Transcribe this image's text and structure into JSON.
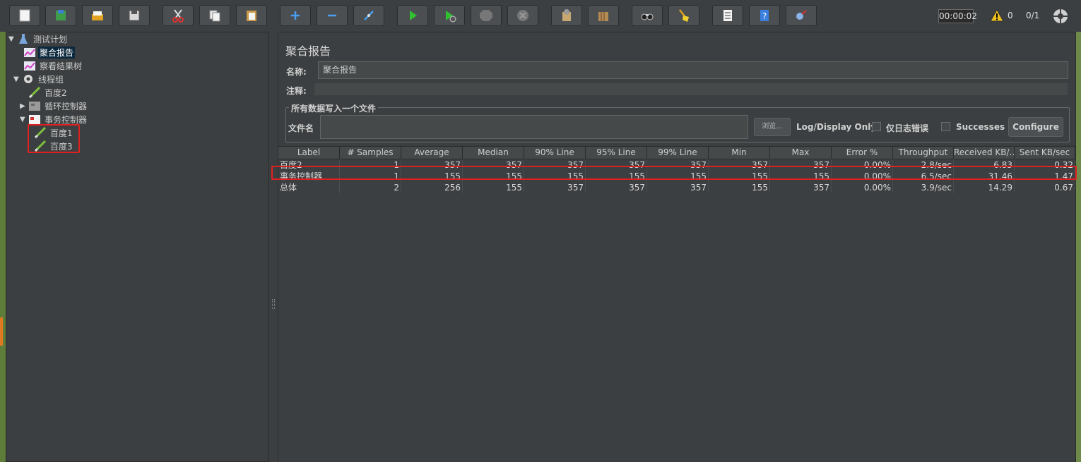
{
  "toolbar": {
    "buttons": [
      {
        "name": "new",
        "icon": "new-file-icon"
      },
      {
        "name": "templates",
        "icon": "templates-icon"
      },
      {
        "name": "open",
        "icon": "open-folder-icon"
      },
      {
        "name": "save",
        "icon": "save-icon"
      },
      {
        "name": "cut",
        "icon": "cut-icon"
      },
      {
        "name": "copy",
        "icon": "copy-icon"
      },
      {
        "name": "paste",
        "icon": "paste-icon"
      },
      {
        "name": "expand",
        "icon": "plus-icon"
      },
      {
        "name": "collapse",
        "icon": "minus-icon"
      },
      {
        "name": "toggle",
        "icon": "toggle-icon"
      },
      {
        "name": "start",
        "icon": "play-icon"
      },
      {
        "name": "start-no-pauses",
        "icon": "play-no-pause-icon"
      },
      {
        "name": "stop",
        "icon": "stop-icon"
      },
      {
        "name": "shutdown",
        "icon": "shutdown-icon"
      },
      {
        "name": "clear",
        "icon": "clear-icon"
      },
      {
        "name": "clear-all",
        "icon": "clear-all-icon"
      },
      {
        "name": "search",
        "icon": "binoculars-icon"
      },
      {
        "name": "reset-search",
        "icon": "broom-icon"
      },
      {
        "name": "function-helper",
        "icon": "list-icon"
      },
      {
        "name": "help",
        "icon": "help-icon"
      },
      {
        "name": "remote",
        "icon": "remote-icon"
      }
    ],
    "timer": "00:00:02",
    "warning_count": "0",
    "threads": "0/1"
  },
  "tree": {
    "items": [
      {
        "label": "测试计划",
        "icon": "test-plan-icon"
      },
      {
        "label": "聚合报告",
        "icon": "listener-chart-icon"
      },
      {
        "label": "察看结果树",
        "icon": "listener-chart-icon"
      },
      {
        "label": "线程组",
        "icon": "gear-icon"
      },
      {
        "label": "百度2",
        "icon": "sampler-pen-icon"
      },
      {
        "label": "循环控制器",
        "icon": "controller-icon"
      },
      {
        "label": "事务控制器",
        "icon": "transaction-icon"
      },
      {
        "label": "百度1",
        "icon": "sampler-pen-icon"
      },
      {
        "label": "百度3",
        "icon": "sampler-pen-icon"
      }
    ]
  },
  "panel": {
    "title": "聚合报告",
    "name_label": "名称:",
    "name_value": "聚合报告",
    "comment_label": "注释:",
    "file_section_title": "所有数据写入一个文件",
    "file_label": "文件名",
    "browse_label": "浏览...",
    "log_display_label": "Log/Display Only:",
    "errors_only_label": "仅日志错误",
    "successes_label": "Successes",
    "configure_label": "Configure"
  },
  "table": {
    "headers": [
      "Label",
      "# Samples",
      "Average",
      "Median",
      "90% Line",
      "95% Line",
      "99% Line",
      "Min",
      "Max",
      "Error %",
      "Throughput",
      "Received KB/...",
      "Sent KB/sec"
    ],
    "rows": [
      [
        "百度2",
        "1",
        "357",
        "357",
        "357",
        "357",
        "357",
        "357",
        "357",
        "0.00%",
        "2.8/sec",
        "6.83",
        "0.32"
      ],
      [
        "事务控制器",
        "1",
        "155",
        "155",
        "155",
        "155",
        "155",
        "155",
        "155",
        "0.00%",
        "6.5/sec",
        "31.46",
        "1.47"
      ],
      [
        "总体",
        "2",
        "256",
        "155",
        "357",
        "357",
        "357",
        "155",
        "357",
        "0.00%",
        "3.9/sec",
        "14.29",
        "0.67"
      ]
    ]
  },
  "colors": {
    "background": "#3c3f41",
    "highlight_border": "#e02020",
    "selection": "#0d293e"
  }
}
